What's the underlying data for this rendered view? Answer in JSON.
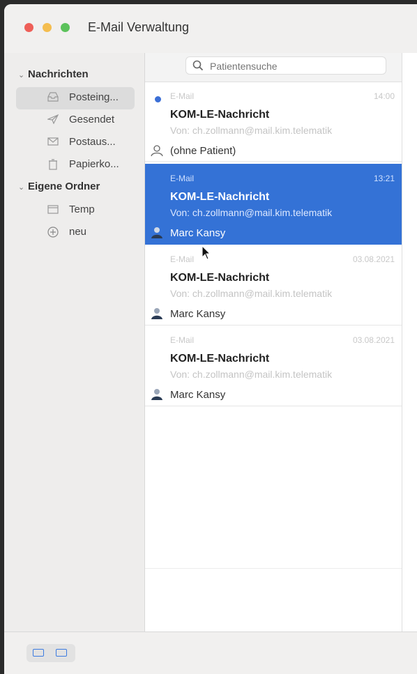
{
  "window": {
    "title": "E-Mail Verwaltung"
  },
  "sidebar": {
    "sections": [
      {
        "label": "Nachrichten"
      },
      {
        "label": "Eigene Ordner"
      }
    ],
    "items": [
      {
        "label": "Posteing...",
        "icon": "inbox-icon"
      },
      {
        "label": "Gesendet",
        "icon": "paper-plane-icon"
      },
      {
        "label": "Postaus...",
        "icon": "outbox-icon"
      },
      {
        "label": "Papierko...",
        "icon": "trash-icon"
      },
      {
        "label": "Temp",
        "icon": "folder-icon"
      },
      {
        "label": "neu",
        "icon": "plus-circle-icon"
      }
    ]
  },
  "search": {
    "placeholder": "Patientensuche"
  },
  "mails": [
    {
      "type": "E-Mail",
      "time": "14:00",
      "subject": "KOM-LE-Nachricht",
      "from": "Von: ch.zollmann@mail.kim.telematik",
      "patient": "(ohne Patient)",
      "unread": true
    },
    {
      "type": "E-Mail",
      "time": "13:21",
      "subject": "KOM-LE-Nachricht",
      "from": "Von: ch.zollmann@mail.kim.telematik",
      "patient": "Marc Kansy",
      "selected": true
    },
    {
      "type": "E-Mail",
      "time": "03.08.2021",
      "subject": "KOM-LE-Nachricht",
      "from": "Von: ch.zollmann@mail.kim.telematik",
      "patient": "Marc Kansy"
    },
    {
      "type": "E-Mail",
      "time": "03.08.2021",
      "subject": "KOM-LE-Nachricht",
      "from": "Von: ch.zollmann@mail.kim.telematik",
      "patient": "Marc Kansy"
    }
  ],
  "colors": {
    "selection": "#3472d6",
    "unread_dot": "#3b6fd6",
    "close": "#ee5f58",
    "minimize": "#f4bd4f",
    "zoom": "#5cc25b"
  }
}
